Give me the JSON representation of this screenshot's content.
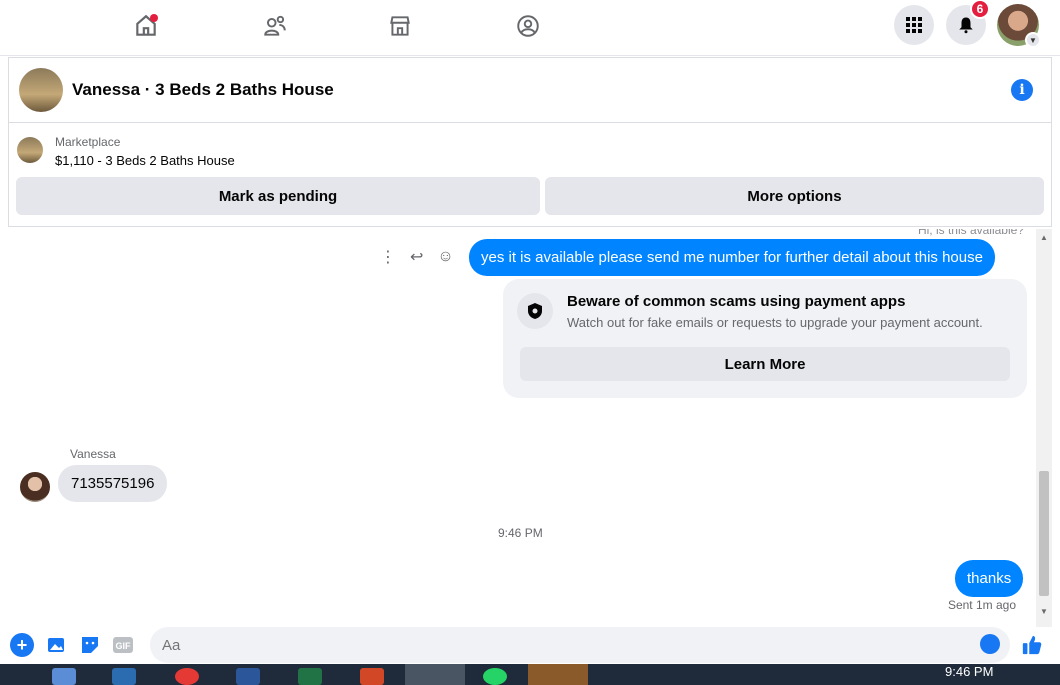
{
  "nav": {
    "items": [
      "home-icon",
      "friends-icon",
      "marketplace-icon",
      "groups-icon"
    ],
    "notification_count": "6"
  },
  "chat": {
    "title": "Vanessa · 3 Beds 2 Baths House",
    "marketplace_label": "Marketplace",
    "listing": "$1,110 - 3 Beds 2 Baths House",
    "mark_pending_label": "Mark as pending",
    "more_options_label": "More options"
  },
  "messages": {
    "faded_top": "Hi, is this available?",
    "outgoing_1": "yes it is available please send me number for further detail about this house",
    "scam_title": "Beware of common scams using payment apps",
    "scam_sub": "Watch out for fake emails or requests to upgrade your payment account.",
    "learn_more": "Learn More",
    "sender_name": "Vanessa",
    "incoming_1": "7135575196",
    "time_divider": "9:46 PM",
    "outgoing_2": "thanks",
    "sent_status": "Sent 1m ago"
  },
  "composer": {
    "placeholder": "Aa",
    "gif_label": "GIF"
  },
  "taskbar": {
    "time": "9:46 PM"
  },
  "colors": {
    "accent": "#1877f2",
    "bubble_out": "#0084ff",
    "badge": "#e41e3f"
  }
}
